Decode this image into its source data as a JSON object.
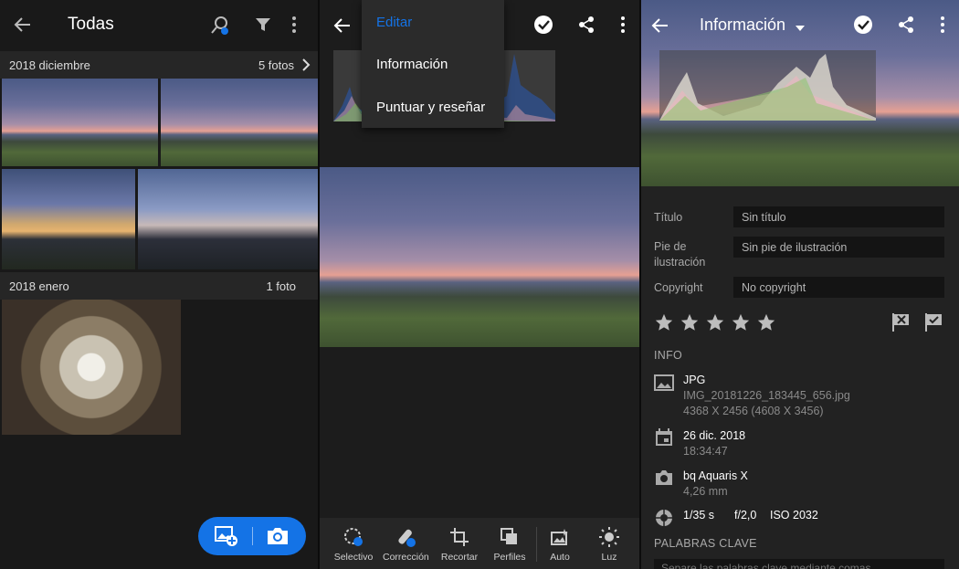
{
  "colors": {
    "accent": "#1473e6",
    "bg_dark": "#191919",
    "section_bg": "#262626",
    "field_bg": "#141414"
  },
  "panel1": {
    "title": "Todas",
    "icons": [
      "back-arrow-icon",
      "people-search-icon",
      "filter-icon",
      "more-vertical-icon"
    ],
    "sections": [
      {
        "date": "2018 diciembre",
        "count": "5 fotos"
      },
      {
        "date": "2018 enero",
        "count": "1 foto"
      }
    ],
    "fab": {
      "add_icon": "add-photo-icon",
      "camera_icon": "camera-icon"
    }
  },
  "panel2": {
    "menu": {
      "items": [
        "Editar",
        "Información",
        "Puntuar y reseñar"
      ],
      "active": "Editar"
    },
    "icons": [
      "back-arrow-icon",
      "check-circle-icon",
      "share-icon",
      "more-vertical-icon"
    ],
    "tools": [
      {
        "label": "Selectivo",
        "icon": "selective-icon"
      },
      {
        "label": "Corrección",
        "icon": "healing-brush-icon"
      },
      {
        "label": "Recortar",
        "icon": "crop-icon"
      },
      {
        "label": "Perfiles",
        "icon": "profiles-icon"
      },
      {
        "label": "Auto",
        "icon": "auto-icon"
      },
      {
        "label": "Luz",
        "icon": "light-icon"
      }
    ]
  },
  "panel3": {
    "title": "Información",
    "fields": [
      {
        "label": "Título",
        "value": "Sin título"
      },
      {
        "label": "Pie de ilustración",
        "value": "Sin pie de ilustración"
      },
      {
        "label": "Copyright",
        "value": "No copyright"
      }
    ],
    "rating": {
      "stars": 0,
      "max": 5
    },
    "flags": [
      "reject-flag-icon",
      "pick-flag-icon"
    ],
    "info_header": "INFO",
    "file": {
      "type": "JPG",
      "name": "IMG_20181226_183445_656.jpg",
      "dims": "4368 X 2456 (4608 X 3456)"
    },
    "date": {
      "day": "26 dic. 2018",
      "time": "18:34:47"
    },
    "camera": {
      "model": "bq Aquaris X",
      "focal": "4,26 mm"
    },
    "exposure": {
      "shutter": "1/35 s",
      "aperture": "f/2,0",
      "iso": "ISO 2032"
    },
    "keywords_header": "PALABRAS CLAVE",
    "keywords_placeholder": "Separe las palabras clave mediante comas"
  }
}
